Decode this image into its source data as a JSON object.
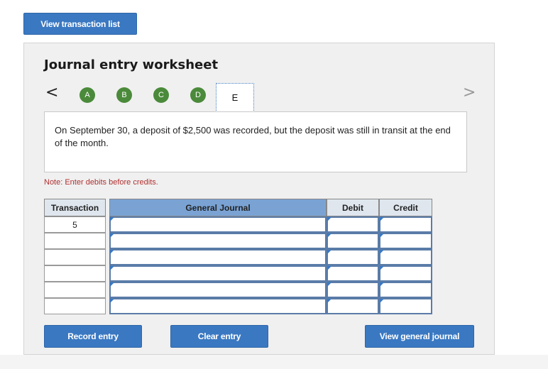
{
  "top_button": {
    "label": "View transaction list"
  },
  "worksheet": {
    "title": "Journal entry worksheet",
    "nav_prev": "<",
    "nav_next": ">",
    "steps": [
      "A",
      "B",
      "C",
      "D"
    ],
    "current_step": "E",
    "description": "On September 30, a deposit of $2,500 was recorded, but the deposit was still in transit at the end of the month.",
    "note": "Note: Enter debits before credits."
  },
  "table": {
    "headers": {
      "transaction": "Transaction",
      "general_journal": "General Journal",
      "debit": "Debit",
      "credit": "Credit"
    },
    "rows": [
      {
        "transaction": "5",
        "general_journal": "",
        "debit": "",
        "credit": ""
      },
      {
        "transaction": "",
        "general_journal": "",
        "debit": "",
        "credit": ""
      },
      {
        "transaction": "",
        "general_journal": "",
        "debit": "",
        "credit": ""
      },
      {
        "transaction": "",
        "general_journal": "",
        "debit": "",
        "credit": ""
      },
      {
        "transaction": "",
        "general_journal": "",
        "debit": "",
        "credit": ""
      },
      {
        "transaction": "",
        "general_journal": "",
        "debit": "",
        "credit": ""
      }
    ]
  },
  "actions": {
    "record": "Record entry",
    "clear": "Clear entry",
    "view_journal": "View general journal"
  },
  "colors": {
    "button": "#3a78c2",
    "step_done": "#4a8a3a",
    "note": "#b03030",
    "header_accent": "#7aa3d4"
  }
}
